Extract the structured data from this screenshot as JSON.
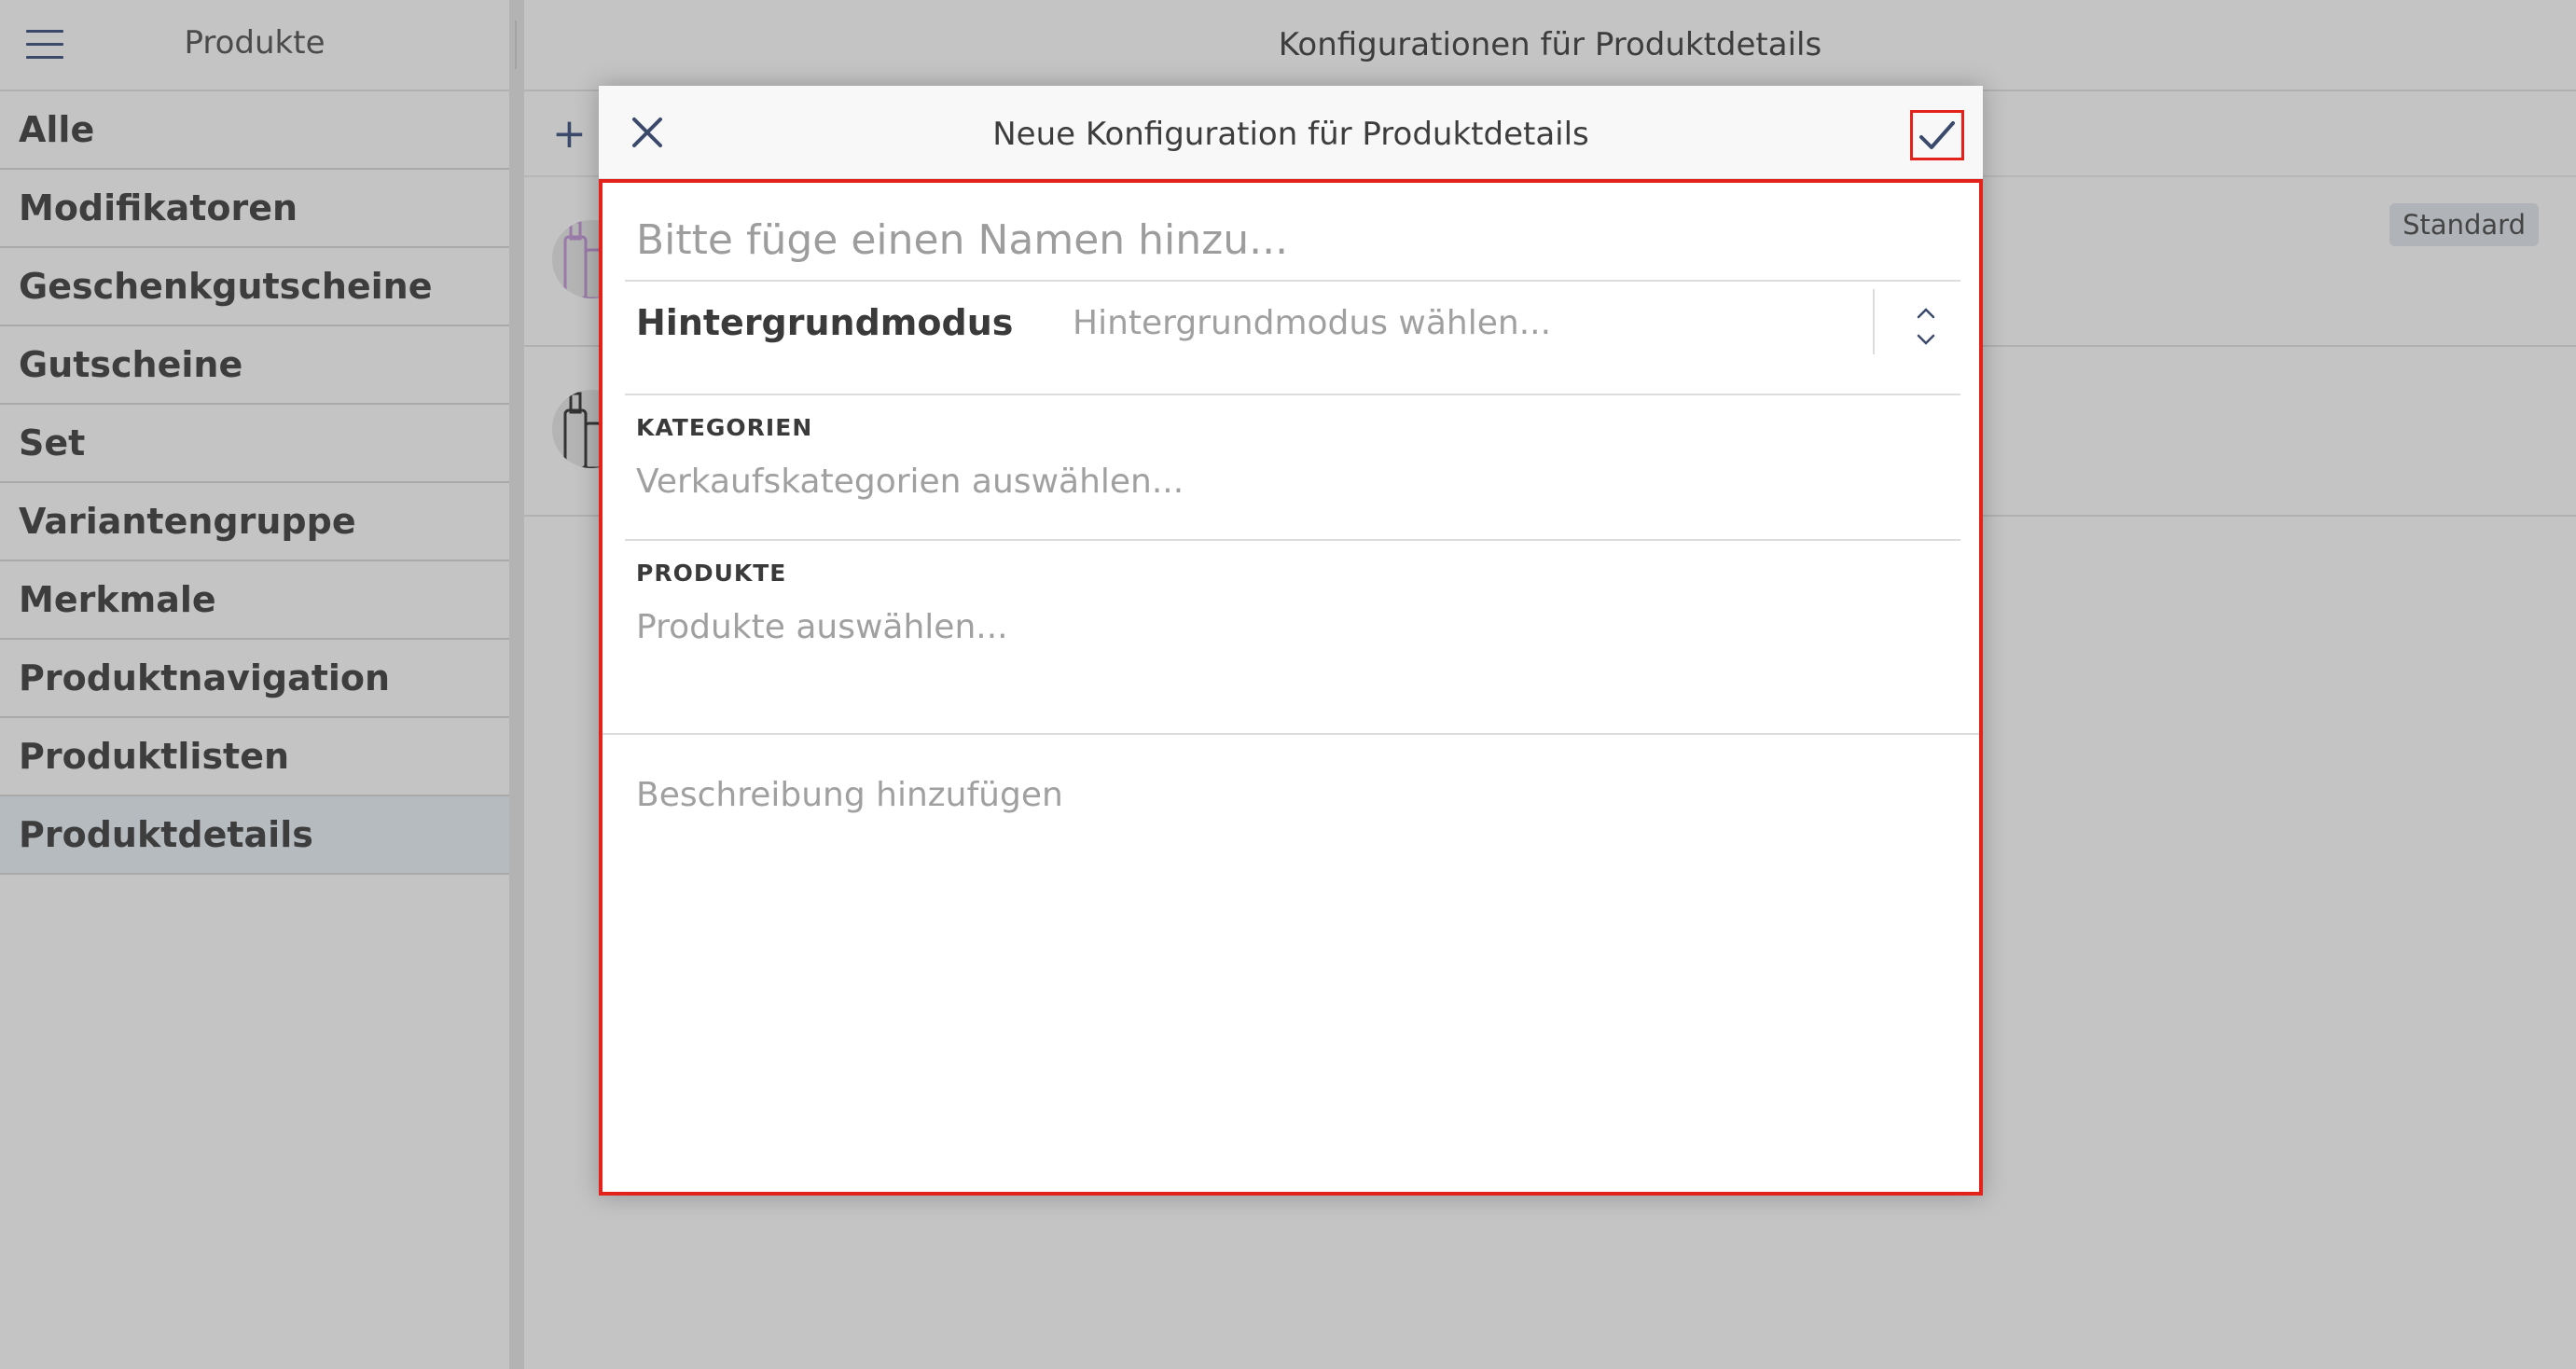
{
  "sidebar": {
    "title": "Produkte",
    "items": [
      {
        "label": "Alle"
      },
      {
        "label": "Modifikatoren"
      },
      {
        "label": "Geschenkgutscheine"
      },
      {
        "label": "Gutscheine"
      },
      {
        "label": "Set"
      },
      {
        "label": "Variantengruppe"
      },
      {
        "label": "Merkmale"
      },
      {
        "label": "Produktnavigation"
      },
      {
        "label": "Produktlisten"
      },
      {
        "label": "Produktdetails",
        "active": true
      }
    ]
  },
  "main": {
    "title": "Konfigurationen für Produktdetails",
    "rows": [
      {
        "badge": "Standard"
      },
      {
        "badge": ""
      }
    ]
  },
  "modal": {
    "title": "Neue Konfiguration für Produktdetails",
    "name_placeholder": "Bitte füge einen Namen hinzu...",
    "background_mode_label": "Hintergrundmodus",
    "background_mode_placeholder": "Hintergrundmodus wählen...",
    "categories_label": "KATEGORIEN",
    "categories_placeholder": "Verkaufskategorien auswählen...",
    "products_label": "PRODUKTE",
    "products_placeholder": "Produkte auswählen...",
    "description_placeholder": "Beschreibung hinzufügen"
  },
  "colors": {
    "accent": "#3b4a6b",
    "highlight": "#e2221b",
    "overlay": "#c4c4c4"
  }
}
